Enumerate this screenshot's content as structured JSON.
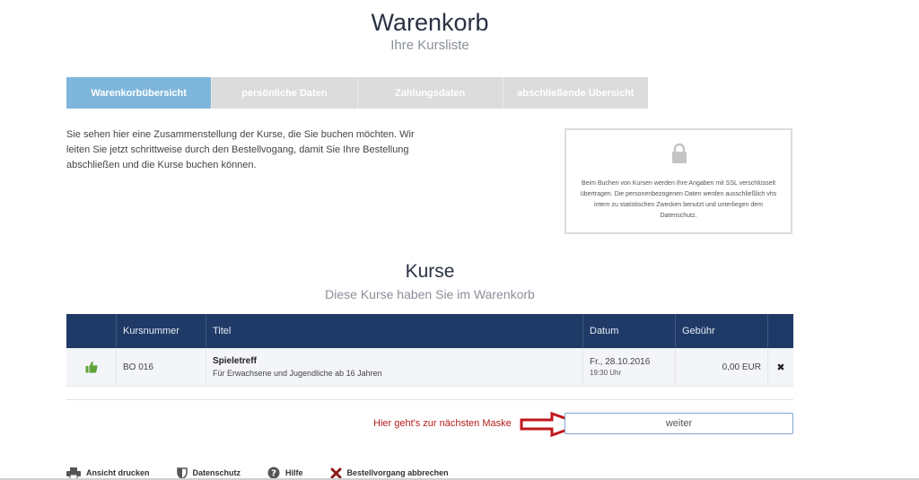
{
  "header": {
    "title": "Warenkorb",
    "subtitle": "Ihre Kursliste"
  },
  "stepper": [
    {
      "label": "Warenkorbübersicht",
      "active": true
    },
    {
      "label": "persönliche Daten",
      "active": false
    },
    {
      "label": "Zahlungsdaten",
      "active": false
    },
    {
      "label": "abschließende Übersicht",
      "active": false
    }
  ],
  "intro": "Sie sehen hier eine Zusammenstellung der Kurse, die Sie buchen möchten. Wir leiten Sie jetzt schrittweise durch den Bestellvogang, damit Sie Ihre Bestellung ab­schließen und die Kurse buchen können.",
  "ssl": {
    "icon": "lock-icon",
    "text": "Beim Buchen von Kursen werden Ihre Angaben mit SSL verschlüsselt übertragen. Die personenbezogenen Daten werden ausschließlich vhs intern zu statistischen Zwecken benutzt und unterliegen dem Datenschutz."
  },
  "courses": {
    "title": "Kurse",
    "subtitle": "Diese Kurse haben Sie im Warenkorb",
    "columns": [
      "",
      "Kursnummer",
      "Titel",
      "Datum",
      "Gebühr",
      ""
    ],
    "rows": [
      {
        "icon": "thumbs-up-icon",
        "number": "BO 016",
        "title": "Spieletreff",
        "description": "Für Erwachsene und Jugendliche ab 16 Jahren",
        "date": "Fr., 28.10.2016",
        "time": "19:30 Uhr",
        "fee": "0,00 EUR",
        "remove": "✖"
      }
    ]
  },
  "next": {
    "hint": "Hier geht's zur nächsten Maske",
    "button": "weiter"
  },
  "footer": [
    {
      "label": "Ansicht drucken",
      "icon": "printer-icon"
    },
    {
      "label": "Datenschutz",
      "icon": "shield-icon"
    },
    {
      "label": "Hilfe",
      "icon": "help-icon"
    },
    {
      "label": "Bestellvorgang abbrechen",
      "icon": "cancel-icon"
    }
  ],
  "colors": {
    "accent": "#7fb6dc",
    "table_header": "#1f3a66",
    "hint": "#b51b1b",
    "thumbs": "#5fa33a"
  }
}
